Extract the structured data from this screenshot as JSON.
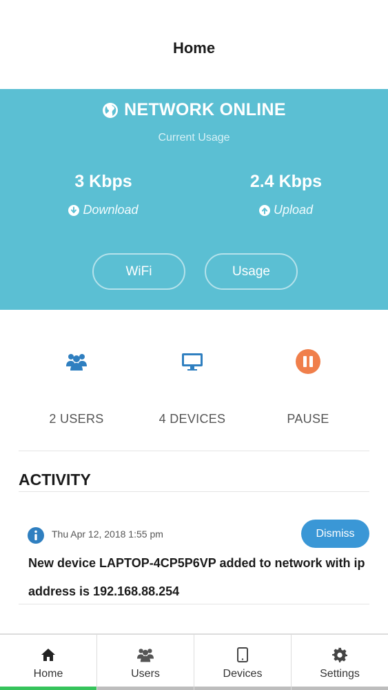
{
  "header": {
    "title": "Home"
  },
  "status": {
    "text": "NETWORK ONLINE",
    "subtitle": "Current Usage",
    "download": {
      "value": "3 Kbps",
      "label": "Download"
    },
    "upload": {
      "value": "2.4 Kbps",
      "label": "Upload"
    },
    "buttons": {
      "wifi": "WiFi",
      "usage": "Usage"
    },
    "colors": {
      "panel": "#5bbfd3"
    }
  },
  "quick_actions": {
    "users": {
      "label": "2 USERS",
      "icon": "users-icon"
    },
    "devices": {
      "label": "4 DEVICES",
      "icon": "monitor-icon"
    },
    "pause": {
      "label": "PAUSE",
      "icon": "pause-icon"
    }
  },
  "activity": {
    "title": "ACTIVITY",
    "items": [
      {
        "icon": "info-icon",
        "timestamp": "Thu Apr 12, 2018 1:55 pm",
        "dismiss_label": "Dismiss",
        "message": "New device LAPTOP-4CP5P6VP added to network with ip address is 192.168.88.254"
      }
    ]
  },
  "tabbar": {
    "tabs": [
      {
        "label": "Home",
        "icon": "home-icon",
        "active": true
      },
      {
        "label": "Users",
        "icon": "users-icon",
        "active": false
      },
      {
        "label": "Devices",
        "icon": "tablet-icon",
        "active": false
      },
      {
        "label": "Settings",
        "icon": "gear-icon",
        "active": false
      }
    ],
    "active_color": "#36c35b"
  }
}
